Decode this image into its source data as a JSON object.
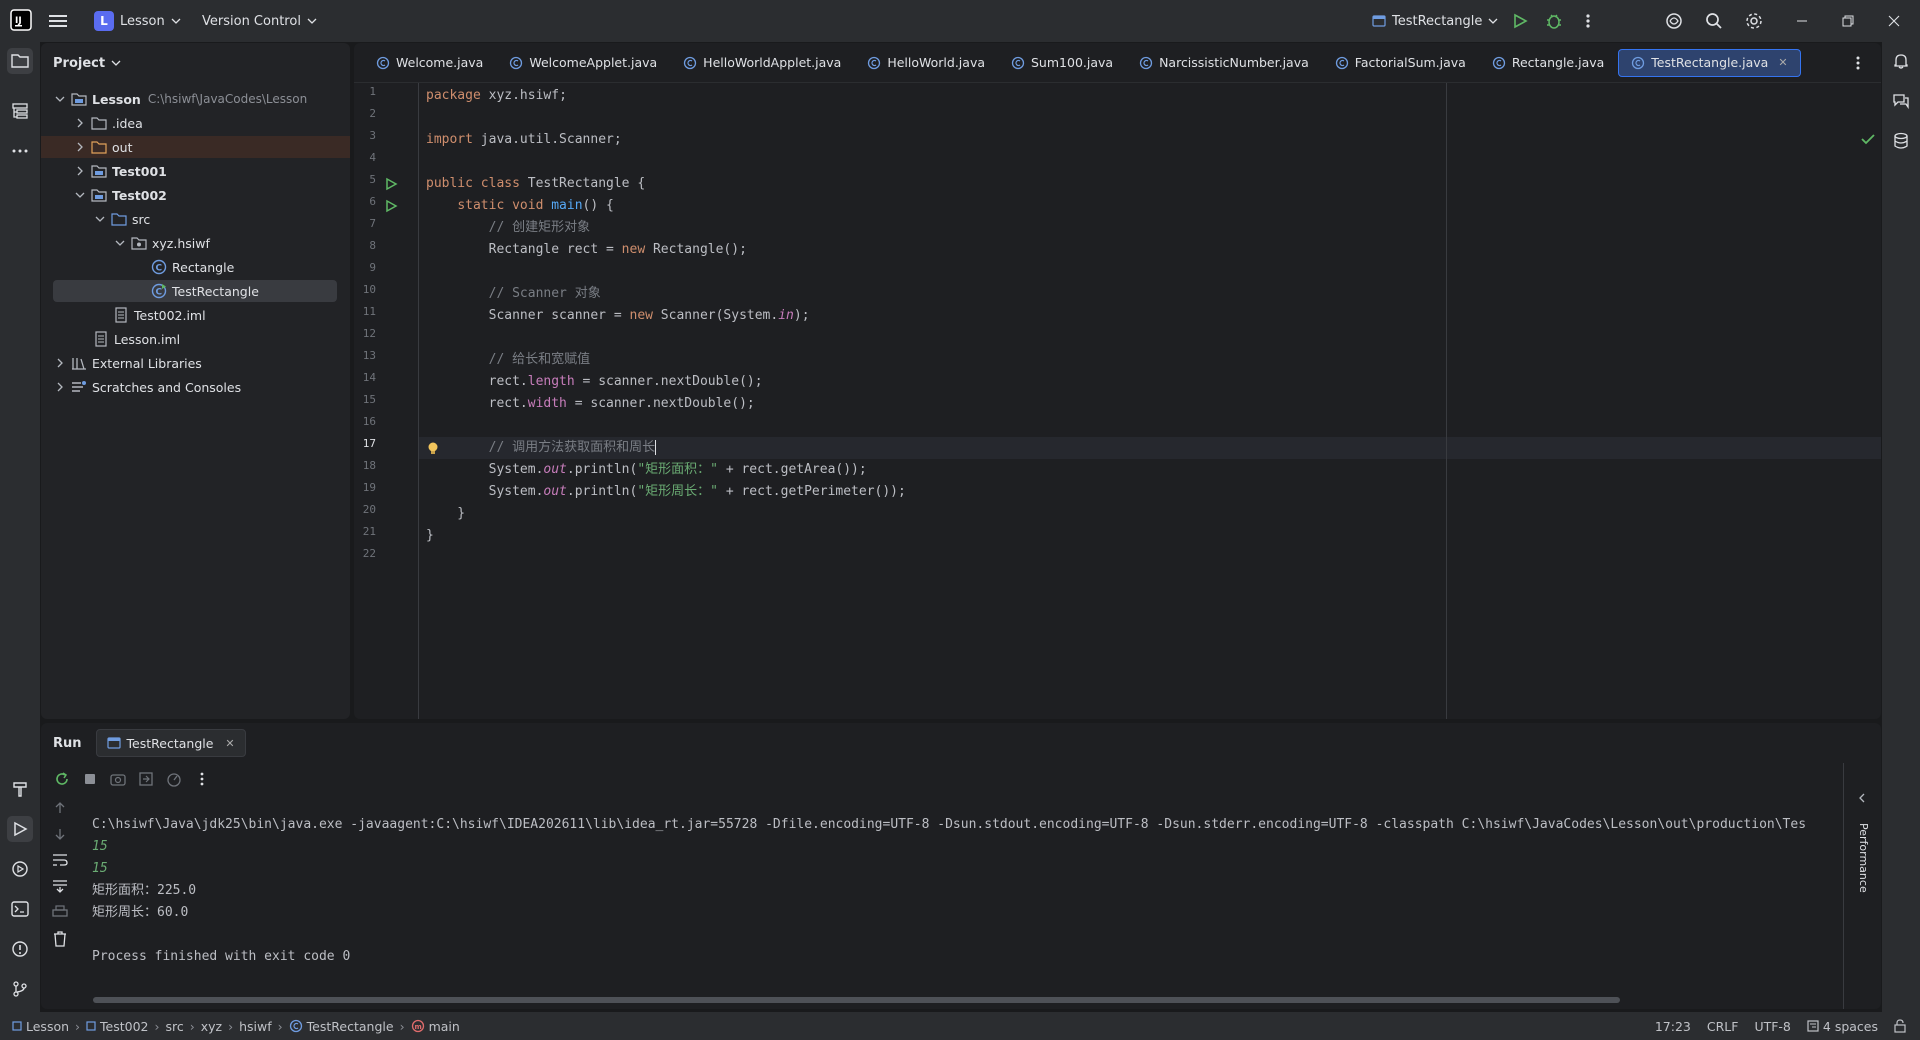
{
  "titlebar": {
    "project_badge": "L",
    "project_name": "Lesson",
    "vcs_label": "Version Control",
    "run_config": "TestRectangle"
  },
  "project_panel": {
    "title": "Project",
    "tree": [
      {
        "label": "Lesson",
        "path": "C:\\hsiwf\\JavaCodes\\Lesson"
      },
      {
        "label": ".idea"
      },
      {
        "label": "out"
      },
      {
        "label": "Test001"
      },
      {
        "label": "Test002"
      },
      {
        "label": "src"
      },
      {
        "label": "xyz.hsiwf"
      },
      {
        "label": "Rectangle"
      },
      {
        "label": "TestRectangle"
      },
      {
        "label": "Test002.iml"
      },
      {
        "label": "Lesson.iml"
      },
      {
        "label": "External Libraries"
      },
      {
        "label": "Scratches and Consoles"
      }
    ]
  },
  "tabs": [
    {
      "label": "Welcome.java"
    },
    {
      "label": "WelcomeApplet.java"
    },
    {
      "label": "HelloWorldApplet.java"
    },
    {
      "label": "HelloWorld.java"
    },
    {
      "label": "Sum100.java"
    },
    {
      "label": "NarcissisticNumber.java"
    },
    {
      "label": "FactorialSum.java"
    },
    {
      "label": "Rectangle.java"
    },
    {
      "label": "TestRectangle.java"
    }
  ],
  "code": {
    "line_numbers": [
      "1",
      "2",
      "3",
      "4",
      "5",
      "6",
      "7",
      "8",
      "9",
      "10",
      "11",
      "12",
      "13",
      "14",
      "15",
      "16",
      "17",
      "18",
      "19",
      "20",
      "21",
      "22"
    ],
    "l1_kw": "package",
    "l1_rest": " xyz.hsiwf;",
    "l3_kw": "import",
    "l3_rest": " java.util.Scanner;",
    "l5_kw": "public class",
    "l5_rest": " TestRectangle {",
    "l6_indent": "    ",
    "l6_kw": "static void",
    "l6_sp": " ",
    "l6_fn": "main",
    "l6_rest": "() {",
    "l7": "        // 创建矩形对象",
    "l8_a": "        Rectangle rect = ",
    "l8_kw": "new",
    "l8_b": " Rectangle();",
    "l10": "        // Scanner 对象",
    "l11_a": "        Scanner scanner = ",
    "l11_kw": "new",
    "l11_b": " Scanner(System.",
    "l11_in": "in",
    "l11_c": ");",
    "l13": "        // 给长和宽赋值",
    "l14_a": "        rect.",
    "l14_f": "length",
    "l14_b": " = scanner.nextDouble();",
    "l15_a": "        rect.",
    "l15_f": "width",
    "l15_b": " = scanner.nextDouble();",
    "l17": "        // 调用方法获取面积和周长",
    "l18_a": "        System.",
    "l18_out": "out",
    "l18_b": ".println(",
    "l18_str": "\"矩形面积：\"",
    "l18_c": " + rect.getArea());",
    "l19_a": "        System.",
    "l19_out": "out",
    "l19_b": ".println(",
    "l19_str": "\"矩形周长：\"",
    "l19_c": " + rect.getPerimeter());",
    "l20": "    }",
    "l21": "}"
  },
  "run_panel": {
    "title": "Run",
    "tab_label": "TestRectangle",
    "output": [
      "C:\\hsiwf\\Java\\jdk25\\bin\\java.exe -javaagent:C:\\hsiwf\\IDEA202611\\lib\\idea_rt.jar=55728 -Dfile.encoding=UTF-8 -Dsun.stdout.encoding=UTF-8 -Dsun.stderr.encoding=UTF-8 -classpath C:\\hsiwf\\JavaCodes\\Lesson\\out\\production\\Tes",
      "15",
      "15",
      "矩形面积：225.0",
      "矩形周长：60.0",
      "",
      "Process finished with exit code 0"
    ],
    "performance_label": "Performance"
  },
  "statusbar": {
    "crumbs": [
      "Lesson",
      "Test002",
      "src",
      "xyz",
      "hsiwf",
      "TestRectangle",
      "main"
    ],
    "position": "17:23",
    "line_sep": "CRLF",
    "encoding": "UTF-8",
    "indent": "4 spaces"
  },
  "colors": {
    "accent": "#3574f0",
    "keyword": "#cf8e6d",
    "string": "#6aab73",
    "function": "#56a8f5",
    "field": "#c77dbb",
    "comment": "#7a7e85"
  }
}
